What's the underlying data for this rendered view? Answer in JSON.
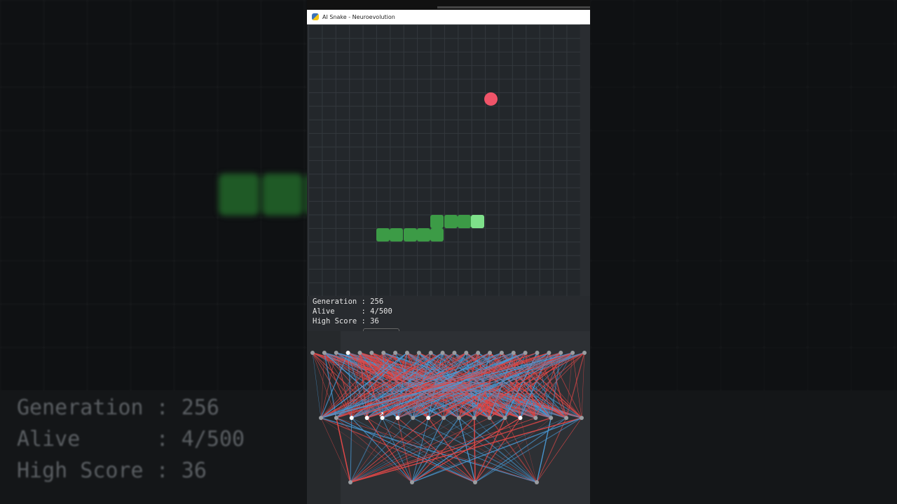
{
  "window": {
    "title": "AI Snake - Neuroevolution",
    "icon": "python-icon"
  },
  "stats": {
    "generation": "Generation : 256",
    "alive": "Alive      : 4/500",
    "high_score": "High Score : 36"
  },
  "bg_stats": {
    "generation": "Generation : 256",
    "alive": "Alive      : 4/500",
    "high_score": "High Score : 36"
  },
  "colors": {
    "food": "#f05469",
    "snake_body": "#3c9b46",
    "snake_head": "#7ee08a",
    "positive_weight": "#4a9ad6",
    "negative_weight": "#e04848",
    "background": "#23272b"
  },
  "network": {
    "layers": [
      24,
      18,
      4
    ],
    "active_hidden": [
      2,
      3,
      4,
      5,
      7,
      13
    ]
  }
}
